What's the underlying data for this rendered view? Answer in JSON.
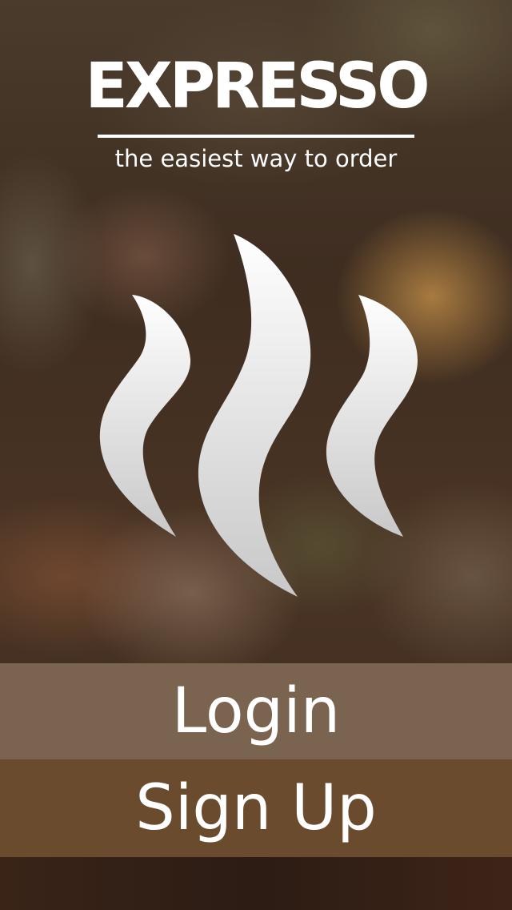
{
  "header": {
    "logo_text": "EXPRESSO",
    "tagline": "the easiest way to order"
  },
  "illustration": {
    "icon": "steam-icon"
  },
  "actions": {
    "login_label": "Login",
    "signup_label": "Sign Up"
  },
  "colors": {
    "login_button_bg": "#7a6450",
    "signup_button_bg": "#6b4b2e",
    "text": "#ffffff"
  }
}
